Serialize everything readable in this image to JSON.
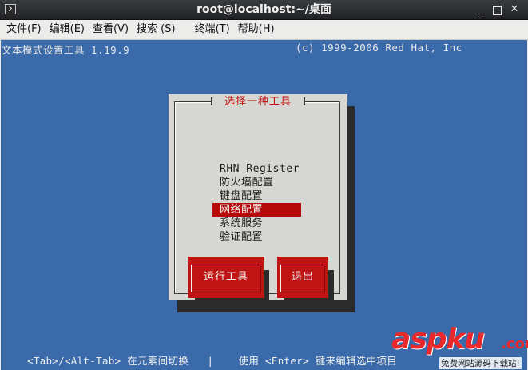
{
  "window": {
    "title": "root@localhost:~/桌面",
    "min_glyph": "_",
    "close_glyph": "✕"
  },
  "menubar": {
    "items": [
      {
        "label": "文件(F)"
      },
      {
        "label": "编辑(E)"
      },
      {
        "label": "查看(V)"
      },
      {
        "label": "搜索 (S)"
      },
      {
        "label": "终端(T)"
      },
      {
        "label": "帮助(H)"
      }
    ]
  },
  "terminal": {
    "header_left": "文本模式设置工具 1.19.9",
    "header_right": "(c) 1999-2006 Red Hat, Inc",
    "footer": "<Tab>/<Alt-Tab> 在元素间切换   |    使用 <Enter> 键来编辑选中项目",
    "bg_color": "#3a6aa9"
  },
  "dialog": {
    "title": "选择一种工具",
    "tools": [
      {
        "label": "RHN Register",
        "selected": false
      },
      {
        "label": "防火墙配置",
        "selected": false
      },
      {
        "label": "键盘配置",
        "selected": false
      },
      {
        "label": "网络配置",
        "selected": true
      },
      {
        "label": "系统服务",
        "selected": false
      },
      {
        "label": "验证配置",
        "selected": false
      }
    ],
    "run_button": "运行工具",
    "quit_button": "退出",
    "accent_color": "#c01414"
  },
  "watermark": {
    "brand": "aspku",
    "tld": ".com",
    "tagline": "免费网站源码下载站!"
  }
}
